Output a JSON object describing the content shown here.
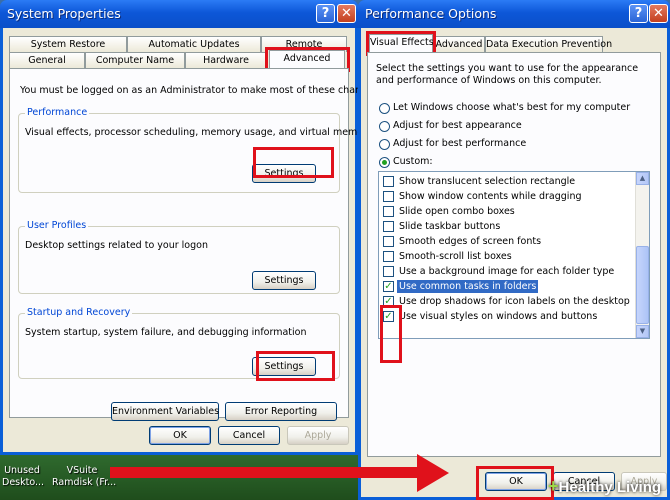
{
  "sysprops": {
    "title": "System Properties",
    "tabs_row1": [
      "System Restore",
      "Automatic Updates",
      "Remote"
    ],
    "tabs_row2": [
      "General",
      "Computer Name",
      "Hardware",
      "Advanced"
    ],
    "notice": "You must be logged on as an Administrator to make most of these changes.",
    "performance": {
      "title": "Performance",
      "desc": "Visual effects, processor scheduling, memory usage, and virtual memory",
      "button": "Settings"
    },
    "user_profiles": {
      "title": "User Profiles",
      "desc": "Desktop settings related to your logon",
      "button": "Settings"
    },
    "startup": {
      "title": "Startup and Recovery",
      "desc": "System startup, system failure, and debugging information",
      "button": "Settings"
    },
    "env_button": "Environment Variables",
    "error_button": "Error Reporting",
    "ok": "OK",
    "cancel": "Cancel",
    "apply": "Apply"
  },
  "perfopts": {
    "title": "Performance Options",
    "tabs": [
      "Visual Effects",
      "Advanced",
      "Data Execution Prevention"
    ],
    "intro": "Select the settings you want to use for the appearance and performance of Windows on this computer.",
    "radios": [
      {
        "label": "Let Windows choose what's best for my computer",
        "selected": false
      },
      {
        "label": "Adjust for best appearance",
        "selected": false
      },
      {
        "label": "Adjust for best performance",
        "selected": false
      },
      {
        "label": "Custom:",
        "selected": true
      }
    ],
    "items": [
      {
        "label": "Show translucent selection rectangle",
        "checked": false
      },
      {
        "label": "Show window contents while dragging",
        "checked": false
      },
      {
        "label": "Slide open combo boxes",
        "checked": false
      },
      {
        "label": "Slide taskbar buttons",
        "checked": false
      },
      {
        "label": "Smooth edges of screen fonts",
        "checked": false
      },
      {
        "label": "Smooth-scroll list boxes",
        "checked": false
      },
      {
        "label": "Use a background image for each folder type",
        "checked": false
      },
      {
        "label": "Use common tasks in folders",
        "checked": true
      },
      {
        "label": "Use drop shadows for icon labels on the desktop",
        "checked": true
      },
      {
        "label": "Use visual styles on windows and buttons",
        "checked": true
      }
    ],
    "ok": "OK",
    "cancel": "Cancel",
    "apply": "Apply"
  },
  "desktop": {
    "icon1": [
      "Unused",
      "Deskto..."
    ],
    "icon2": [
      "VSuite",
      "Ramdisk (Fr..."
    ]
  },
  "watermark": {
    "plus": "+",
    "text": "Healthy Living"
  },
  "colors": {
    "highlight": "#e0111b",
    "titlebar": "#0a5fd8"
  }
}
